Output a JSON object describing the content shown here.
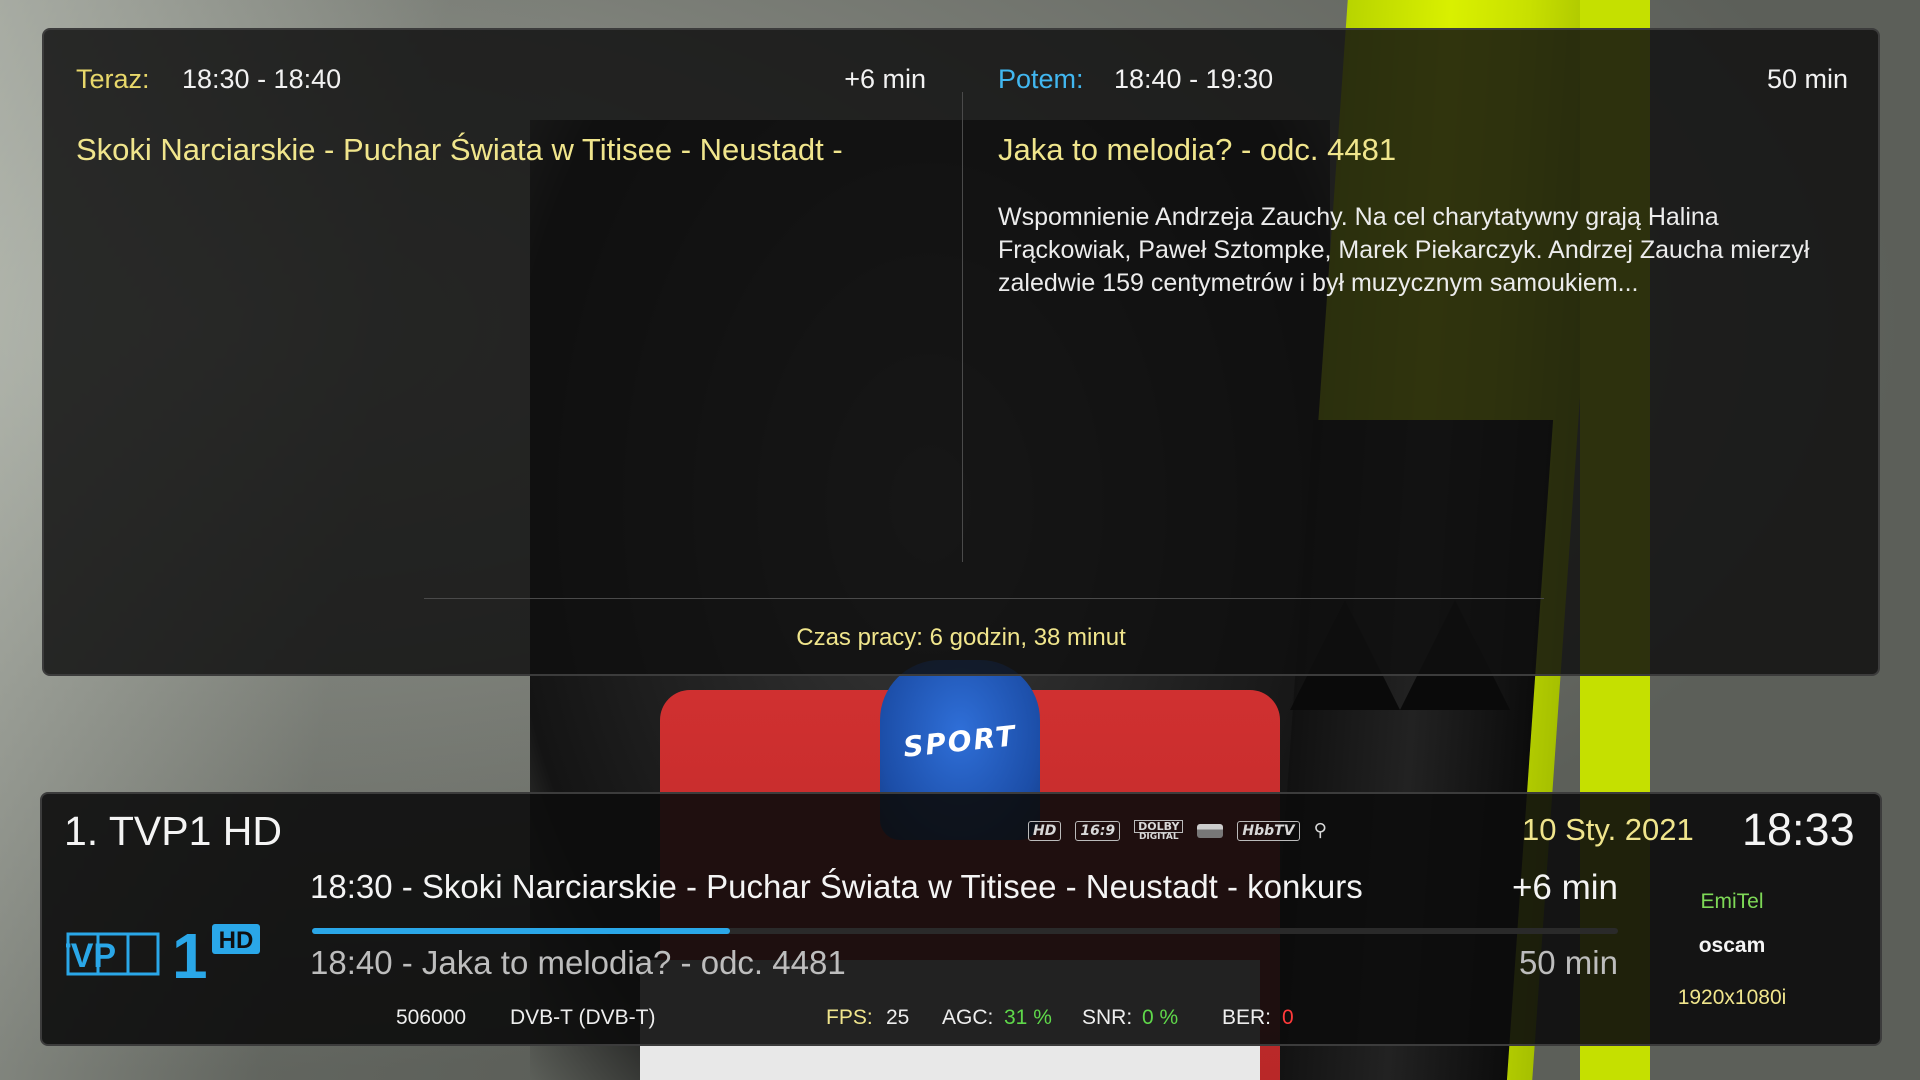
{
  "epg_panel": {
    "now": {
      "label": "Teraz:",
      "time_range": "18:30 - 18:40",
      "remaining": "+6 min",
      "title": "Skoki Narciarskie - Puchar Świata w Titisee - Neustadt -"
    },
    "next": {
      "label": "Potem:",
      "time_range": "18:40 - 19:30",
      "duration": "50 min",
      "title": "Jaka to melodia? - odc. 4481",
      "description": " Wspomnienie Andrzeja Zauchy. Na cel charytatywny grają Halina Frąckowiak, Paweł Sztompke, Marek Piekarczyk. Andrzej Zaucha mierzył zaledwie 159 centymetrów i był muzycznym samoukiem..."
    },
    "uptime": "Czas pracy: 6 godzin, 38 minut"
  },
  "infobar": {
    "channel_name": "1. TVP1 HD",
    "date": "10 Sty. 2021",
    "clock": "18:33",
    "flags": [
      "HD",
      "16:9",
      "DOLBY",
      "DIGITAL",
      "HbbTV"
    ],
    "flag_icons": [
      "hd-icon",
      "aspect-16-9-icon",
      "dolby-digital-icon",
      "crypt-card-icon",
      "hbbtv-icon",
      "satellite-dish-icon"
    ],
    "logo": {
      "text_tvp": "TVP",
      "text_one": "1",
      "text_hd": "HD",
      "color": "#2aa7e8"
    },
    "now_event": "18:30 - Skoki Narciarskie - Puchar Świata w Titisee - Neustadt - konkurs",
    "now_remaining": "+6 min",
    "progress": 0.32,
    "next_event": "18:40 - Jaka to melodia? - odc. 4481",
    "next_duration": "50 min",
    "provider": "EmiTel",
    "cam": "oscam",
    "resolution": "1920x1080i",
    "tech": {
      "frequency": "506000",
      "system": "DVB-T  (DVB-T)",
      "fps_label": "FPS:",
      "fps_value": "25",
      "agc_label": "AGC:",
      "agc_value": "31 %",
      "snr_label": "SNR:",
      "snr_value": "0 %",
      "ber_label": "BER:",
      "ber_value": "0"
    }
  },
  "colors": {
    "accent_blue": "#2aa7e8",
    "text_yellow": "#f0e58c",
    "status_green": "#5fd84a",
    "status_red": "#ff3a3a"
  }
}
